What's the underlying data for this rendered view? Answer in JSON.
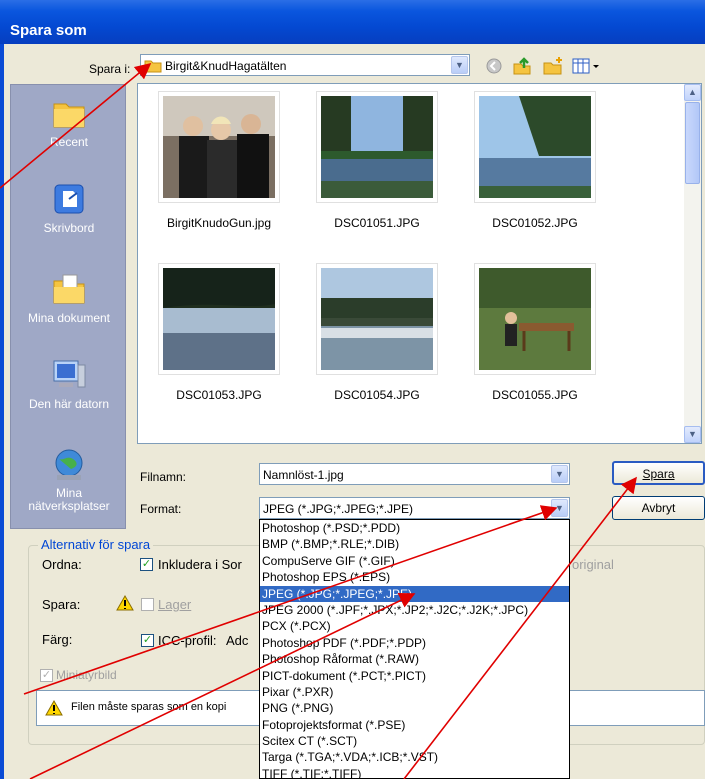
{
  "window": {
    "title": "Spara som"
  },
  "save_in": {
    "label": "Spara i:",
    "value": "Birgit&KnudHagatälten"
  },
  "places": [
    {
      "label": "Recent"
    },
    {
      "label": "Skrivbord"
    },
    {
      "label": "Mina dokument"
    },
    {
      "label": "Den här datorn"
    },
    {
      "label": "Mina nätverksplatser"
    }
  ],
  "files": [
    {
      "name": "BirgitKnudoGun.jpg"
    },
    {
      "name": "DSC01051.JPG"
    },
    {
      "name": "DSC01052.JPG"
    },
    {
      "name": "DSC01053.JPG"
    },
    {
      "name": "DSC01054.JPG"
    },
    {
      "name": "DSC01055.JPG"
    }
  ],
  "filename": {
    "label": "Filnamn:",
    "value": "Namnlöst-1.jpg"
  },
  "format": {
    "label": "Format:",
    "value": "JPEG (*.JPG;*.JPEG;*.JPE)"
  },
  "buttons": {
    "save": "Spara",
    "cancel": "Avbryt"
  },
  "format_options": [
    "Photoshop (*.PSD;*.PDD)",
    "BMP (*.BMP;*.RLE;*.DIB)",
    "CompuServe GIF (*.GIF)",
    "Photoshop EPS (*.EPS)",
    "JPEG (*.JPG;*.JPEG;*.JPE)",
    "JPEG 2000 (*.JPF;*.JPX;*.JP2;*.J2C;*.J2K;*.JPC)",
    "PCX (*.PCX)",
    "Photoshop PDF (*.PDF;*.PDP)",
    "Photoshop Råformat (*.RAW)",
    "PICT-dokument (*.PCT;*.PICT)",
    "Pixar (*.PXR)",
    "PNG (*.PNG)",
    "Fotoprojektsformat (*.PSE)",
    "Scitex CT (*.SCT)",
    "Targa (*.TGA;*.VDA;*.ICB;*.VST)",
    "TIFF (*.TIF;*.TIFF)"
  ],
  "selected_format_index": 4,
  "options": {
    "group_title": "Alternativ för spara",
    "ordna_label": "Ordna:",
    "include_label": "Inkludera i Sor",
    "original_label": "original",
    "spara_label": "Spara:",
    "lager_label": "Lager",
    "farg_label": "Färg:",
    "icc_label": "ICC-profil:",
    "icc_value": "Adc",
    "miniatyr_label": "Miniatyrbild",
    "warning_text": "Filen måste sparas som en kopi"
  },
  "colors": {
    "title_bar": "#0a56de",
    "selection": "#316ac5",
    "arrow": "#e00000"
  }
}
